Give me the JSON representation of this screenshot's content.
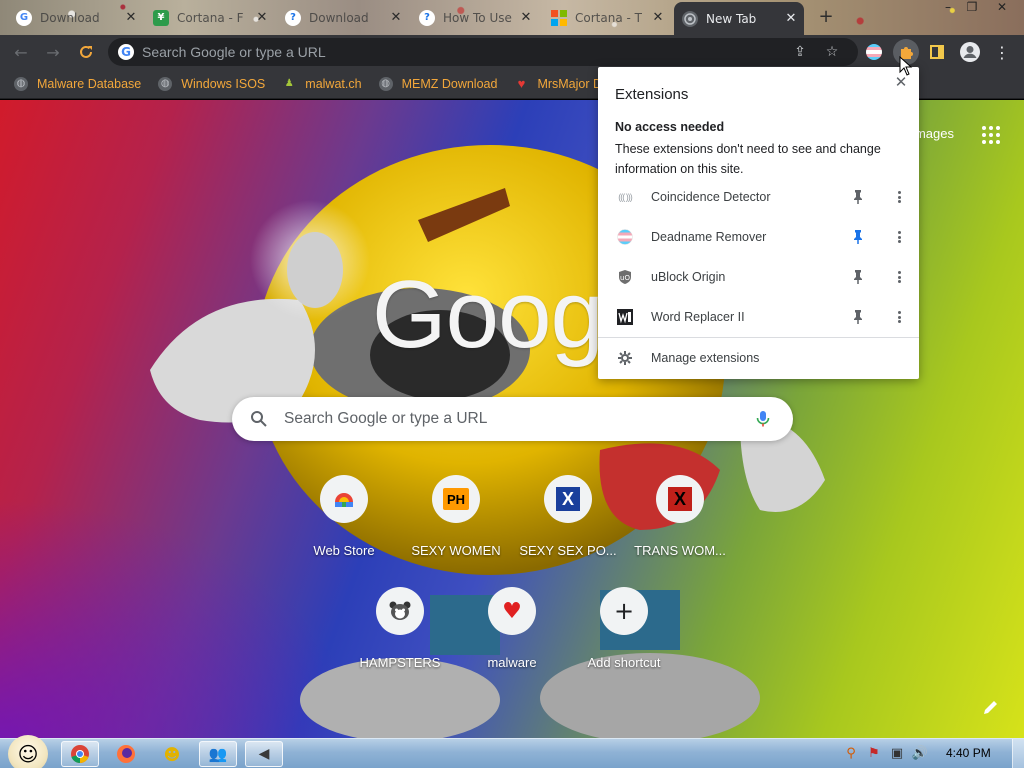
{
  "browser": {
    "tabs": [
      {
        "title": "Download",
        "favicon": "google-favicon",
        "active": false
      },
      {
        "title": "Cortana - F",
        "favicon": "green-shield-favicon",
        "active": false
      },
      {
        "title": "Download",
        "favicon": "help-favicon",
        "active": false
      },
      {
        "title": "How To Use",
        "favicon": "help-favicon",
        "active": false
      },
      {
        "title": "Cortana - T",
        "favicon": "microsoft-favicon",
        "active": false
      },
      {
        "title": "New Tab",
        "favicon": "chrome-favicon",
        "active": true
      }
    ],
    "omnibox_placeholder": "Search Google or type a URL",
    "bookmarks": [
      {
        "label": "Malware Database",
        "icon": "globe-icon"
      },
      {
        "label": "Windows ISOS",
        "icon": "globe-icon"
      },
      {
        "label": "malwat.ch",
        "icon": "android-icon"
      },
      {
        "label": "MEMZ Download",
        "icon": "globe-icon"
      },
      {
        "label": "MrsMajor Dow",
        "icon": "heart-icon"
      }
    ],
    "accent_bookmark_color": "#f2a73b"
  },
  "ntp": {
    "images_link": "Images",
    "logo": "Google",
    "search_placeholder": "Search Google or type a URL",
    "shortcuts": [
      {
        "label": "Web Store",
        "icon": "chrome-webstore-icon"
      },
      {
        "label": "SEXY WOMEN",
        "icon": "ph-logo-icon"
      },
      {
        "label": "SEXY SEX PO...",
        "icon": "x-logo-blue-icon"
      },
      {
        "label": "TRANS WOM...",
        "icon": "x-logo-red-icon"
      },
      {
        "label": "HAMPSTERS",
        "icon": "hamster-icon"
      },
      {
        "label": "malware",
        "icon": "heart-icon"
      },
      {
        "label": "Add shortcut",
        "icon": "plus-icon"
      }
    ]
  },
  "extensions_panel": {
    "title": "Extensions",
    "section_heading": "No access needed",
    "section_description": "These extensions don't need to see and change information on this site.",
    "items": [
      {
        "name": "Coincidence Detector",
        "pinned": false
      },
      {
        "name": "Deadname Remover",
        "pinned": true
      },
      {
        "name": "uBlock Origin",
        "pinned": false
      },
      {
        "name": "Word Replacer II",
        "pinned": false
      }
    ],
    "manage_label": "Manage extensions"
  },
  "taskbar": {
    "time": "4:40 PM"
  }
}
